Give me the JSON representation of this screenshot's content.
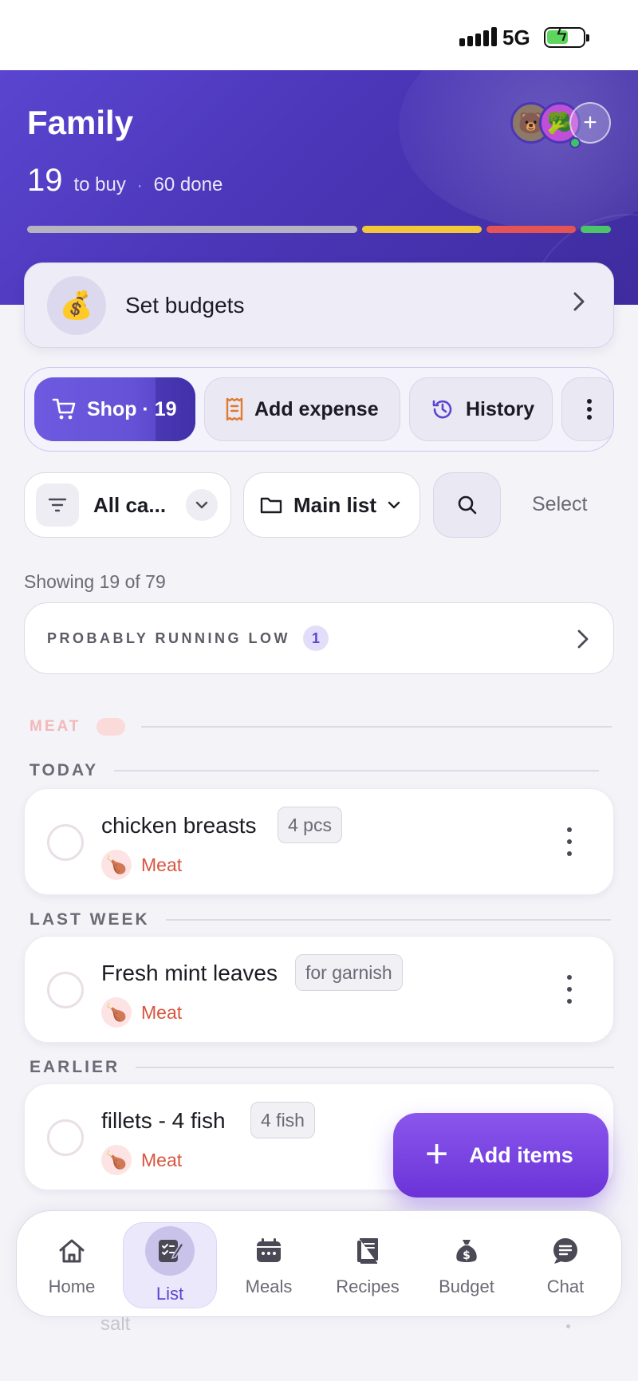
{
  "status_bar": {
    "network": "5G",
    "signal_icon": "signal-bars-icon",
    "battery_icon": "battery-charging-icon"
  },
  "header": {
    "title": "Family",
    "to_buy_count": "19",
    "to_buy_label": "to buy",
    "separator": "·",
    "done_label": "60 done",
    "add_member_symbol": "+",
    "progress_colors": [
      "#b5b3c2",
      "#f2c83a",
      "#e55454",
      "#4cc46a"
    ]
  },
  "budget": {
    "label": "Set budgets",
    "icon": "money-bag-icon"
  },
  "actions": {
    "shop_label": "Shop · 19",
    "expense_label": "Add expense",
    "history_label": "History"
  },
  "filters": {
    "category_label": "All ca...",
    "list_label": "Main list",
    "select_label": "Select"
  },
  "showing_text": "Showing 19 of 79",
  "running_low": {
    "label": "PROBABLY RUNNING LOW",
    "count": "1"
  },
  "sections": {
    "meat_faded": "MEAT",
    "today": "TODAY",
    "last_week": "LAST WEEK",
    "earlier": "EARLIER"
  },
  "items": [
    {
      "name": "chicken breasts",
      "qty": "4 pcs",
      "category": "Meat"
    },
    {
      "name": "Fresh mint leaves",
      "qty": "for garnish",
      "category": "Meat"
    },
    {
      "name": "fillets - 4 fish",
      "qty": "4 fish",
      "category": "Meat"
    }
  ],
  "fab": {
    "label": "Add items",
    "symbol": "+"
  },
  "nav": {
    "home": "Home",
    "list": "List",
    "meals": "Meals",
    "recipes": "Recipes",
    "budget": "Budget",
    "chat": "Chat"
  },
  "peek_text": "salt",
  "colors": {
    "accent": "#5a45d0",
    "meat": "#d8553f",
    "fab": "#7a45e4"
  }
}
